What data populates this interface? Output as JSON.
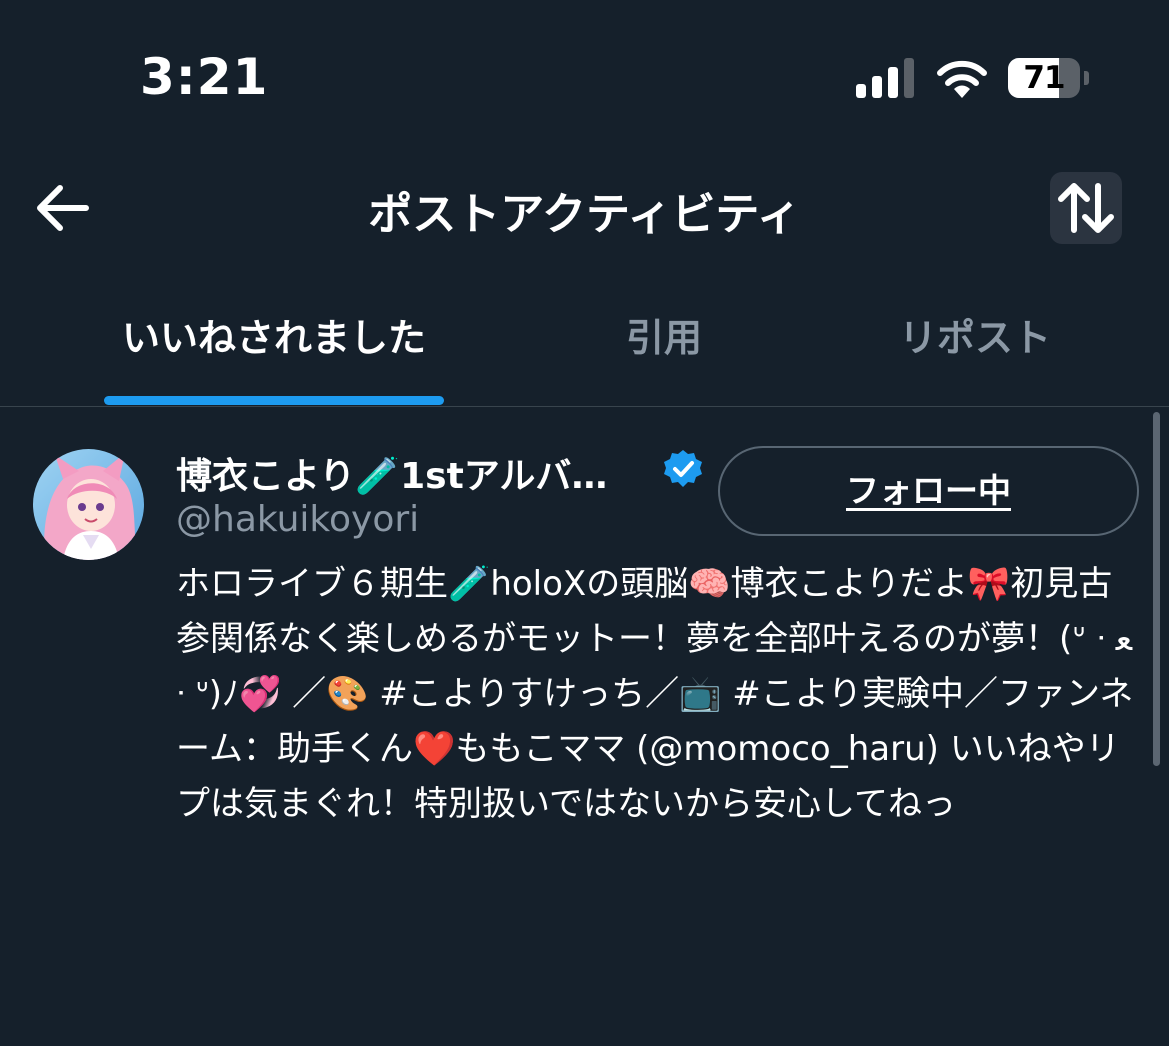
{
  "status_bar": {
    "time": "3:21",
    "battery_level": "71",
    "battery_fraction": 0.71
  },
  "header": {
    "title": "ポストアクティビティ",
    "back_icon": "arrow-left-icon",
    "sort_icon": "sort-arrows-icon"
  },
  "tabs": [
    {
      "label": "いいねされました",
      "active": true
    },
    {
      "label": "引用",
      "active": false
    },
    {
      "label": "リポスト",
      "active": false
    }
  ],
  "user": {
    "display_name": "博衣こより🧪1stアルバ…",
    "handle": "@hakuikoyori",
    "verified": true,
    "follow_label": "フォロー中",
    "bio": "ホロライブ６期生🧪holoXの頭脳🧠博衣こよりだよ🎀初見古参関係なく楽しめるがモットー！夢を全部叶えるのが夢！(ᐡ ᐧ ﻌ ᐧ ᐡ)ﾉ💞 ／🎨 #こよりすけっち／📺 #こより実験中／ファンネーム：助手くん❤️ももこママ (@momoco_haru) いいねやリプは気まぐれ！特別扱いではないから安心してねっ"
  },
  "colors": {
    "background": "#15202b",
    "accent": "#1d9bf0",
    "secondary_text": "#8b98a5"
  }
}
